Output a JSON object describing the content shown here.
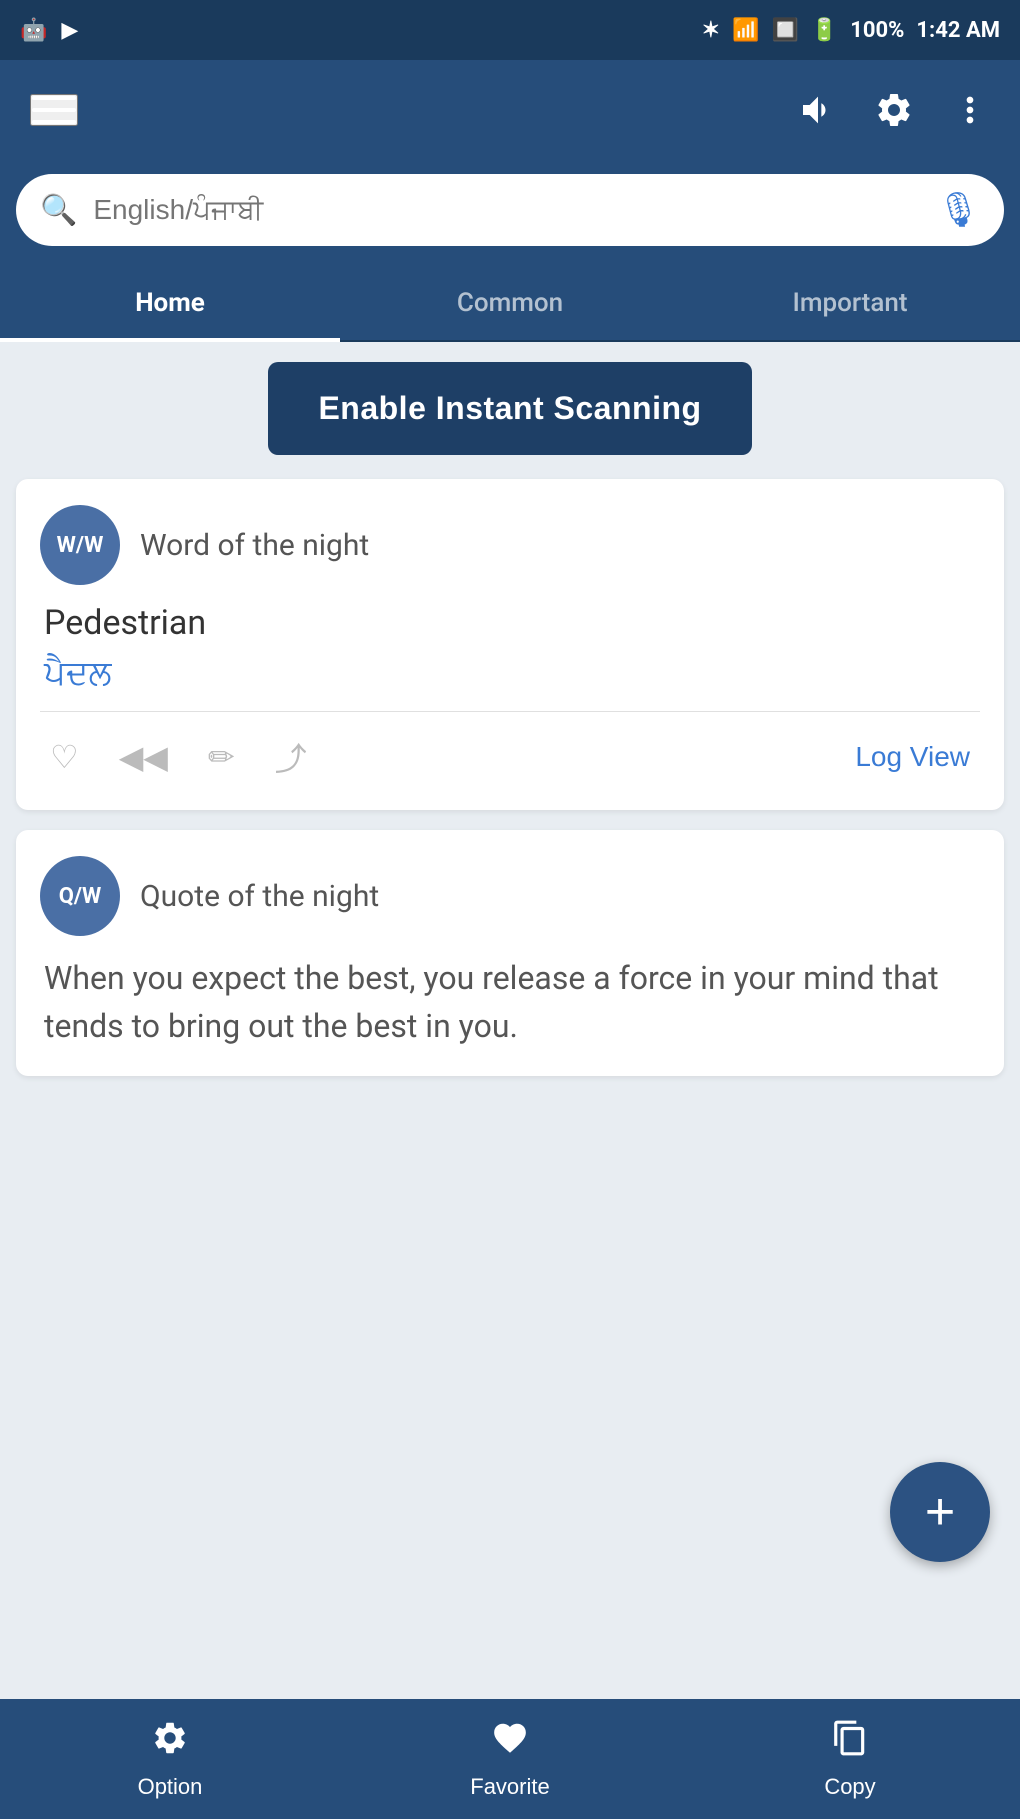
{
  "statusBar": {
    "leftIcons": [
      "android-icon",
      "youtube-icon"
    ],
    "bluetooth": "bluetooth",
    "signal": "signal",
    "wifi": "wifi",
    "question": "?",
    "battery": "100%",
    "time": "1:42 AM"
  },
  "topBar": {
    "menu": "☰",
    "volumeIcon": "🔊",
    "settingsIcon": "⚙",
    "moreIcon": "⋮"
  },
  "searchBar": {
    "placeholder": "English/ਪੰਜਾਬੀ",
    "micIcon": "🎤"
  },
  "tabs": [
    {
      "id": "home",
      "label": "Home",
      "active": true
    },
    {
      "id": "common",
      "label": "Common",
      "active": false
    },
    {
      "id": "important",
      "label": "Important",
      "active": false
    }
  ],
  "instantScan": {
    "label": "Enable Instant Scanning"
  },
  "wordOfNight": {
    "avatarText": "W/W",
    "title": "Word of the night",
    "word": "Pedestrian",
    "translation": "ਪੈਦਲ",
    "logView": "Log View"
  },
  "quoteOfNight": {
    "avatarText": "Q/W",
    "title": "Quote of the night",
    "quoteText": "When you expect the best, you release a force in your mind that tends to bring out the best in you."
  },
  "fab": {
    "icon": "+"
  },
  "bottomNav": [
    {
      "id": "option",
      "icon": "⚙",
      "label": "Option"
    },
    {
      "id": "favorite",
      "icon": "♥",
      "label": "Favorite"
    },
    {
      "id": "copy",
      "icon": "📋",
      "label": "Copy"
    }
  ]
}
